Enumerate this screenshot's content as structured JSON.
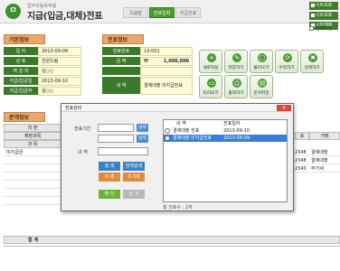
{
  "header": {
    "logo": "ㅁ",
    "subtitle": "업무자동화엑셀",
    "title": "지급(입금,대체)전표",
    "tabs": [
      "도움말",
      "전표입력",
      "지급전표"
    ],
    "active_tab": 1,
    "right_buttons": [
      "시트보호",
      "시트보호",
      "시트해제"
    ],
    "fullscreen_label": "전체화면"
  },
  "basic": {
    "section": "기본정보",
    "rows": [
      {
        "label": "일 자",
        "value": "2013-09-09"
      },
      {
        "label": "상 호",
        "value": "천원드림"
      },
      {
        "label": "작 성 자",
        "value": "김○○"
      },
      {
        "label": "지급/입금일",
        "value": "2013-09-10"
      },
      {
        "label": "지급/입금자",
        "value": "김○○"
      }
    ]
  },
  "voucher": {
    "section": "전표정보",
    "rows": [
      {
        "label": "전표번호",
        "value": "13-001",
        "amount": ""
      },
      {
        "label": "금 액",
        "value": "₩",
        "amount": "1,000,000"
      },
      {
        "label": "",
        "value": "",
        "amount": ""
      },
      {
        "label": "내 역",
        "value": "결제대행 미지급전표",
        "amount": ""
      }
    ]
  },
  "actions": [
    {
      "label": "새로작성",
      "icon": "+"
    },
    {
      "label": "저장하기",
      "icon": "✎"
    },
    {
      "label": "불러오기",
      "icon": "▢"
    },
    {
      "label": "수정하기",
      "icon": "⟳"
    },
    {
      "label": "삭제하기",
      "icon": "✖"
    },
    {
      "label": "미리보기",
      "icon": "▭"
    },
    {
      "label": "출력하기",
      "icon": "⎙"
    },
    {
      "label": "문서저장",
      "icon": "▤"
    }
  ],
  "detail": {
    "section": "분개정보",
    "headers": [
      "차 변",
      "계정과목",
      "과 목",
      "거래처"
    ],
    "left_rows": [
      "미지급금"
    ],
    "right_headers": [
      "호",
      "거래"
    ],
    "right_rows": [
      {
        "no": "2348",
        "name": "결제대행"
      },
      {
        "no": "2348",
        "name": "결제대행"
      },
      {
        "no": "2340",
        "name": "부가세"
      }
    ],
    "total_label": "합 계"
  },
  "dialog": {
    "title": "전표관리",
    "period_label": "전표기간",
    "desc_label": "내 역",
    "mini_btn": "달력",
    "search": "검 색",
    "full_search": "전체검색",
    "delete": "삭 제",
    "init": "초기화",
    "confirm": "확 인",
    "close": "닫 기",
    "list_headers": [
      "내 역",
      "전표일자"
    ],
    "list_rows": [
      {
        "desc": "결제대행 전표",
        "date": "2013-09-10",
        "selected": false
      },
      {
        "desc": "결제대행 미지급전표",
        "date": "2013-09-09",
        "selected": true
      }
    ],
    "count": "총 전표수 : 2개"
  },
  "colors": {
    "green": "#3b7a2a",
    "orange": "#e9a86b",
    "selection": "#3a7fd5"
  }
}
